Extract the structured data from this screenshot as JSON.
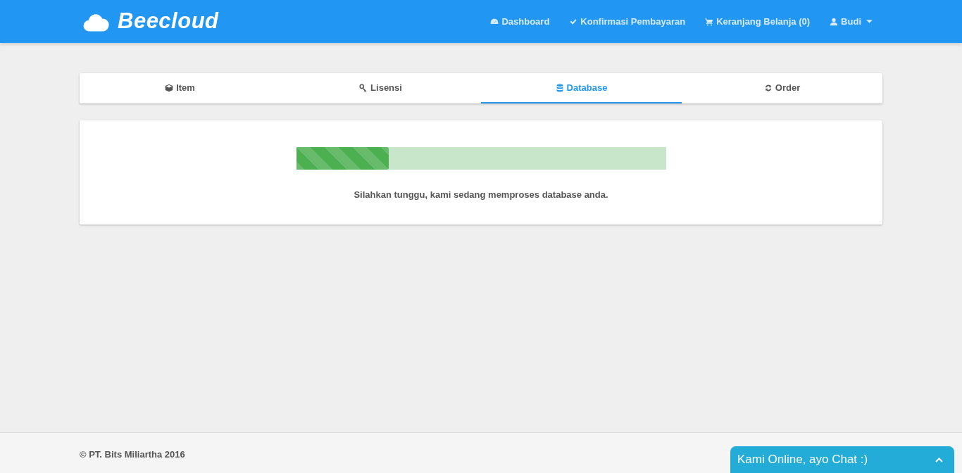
{
  "brand": {
    "name": "Beecloud"
  },
  "nav": [
    {
      "label": "Dashboard"
    },
    {
      "label": "Konfirmasi Pembayaran"
    },
    {
      "label": "Keranjang Belanja (0)"
    },
    {
      "label": "Budi",
      "dropdown": true
    }
  ],
  "tabs": [
    {
      "label": "Item",
      "selected": false
    },
    {
      "label": "Lisensi",
      "selected": false
    },
    {
      "label": "Database",
      "selected": true
    },
    {
      "label": "Order",
      "selected": false
    }
  ],
  "progress": {
    "level": 0.25,
    "message": "Silahkan tunggu, kami sedang memproses database anda."
  },
  "footer": {
    "copyright": "© PT. Bits Miliartha 2016"
  },
  "chat": {
    "label": "Kami Online, ayo Chat :)"
  }
}
